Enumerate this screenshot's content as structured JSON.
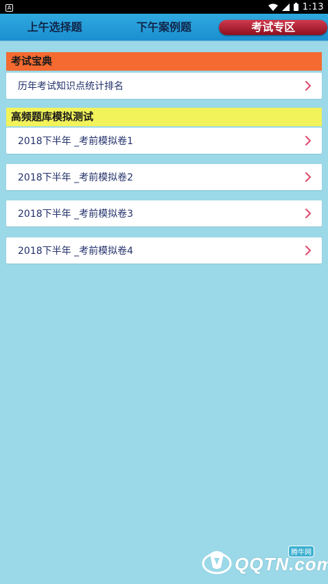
{
  "status_bar": {
    "notification_icon": "A",
    "time": "1:13"
  },
  "tabs": [
    {
      "label": "上午选择题"
    },
    {
      "label": "下午案例题"
    },
    {
      "label": "考试专区"
    }
  ],
  "sections": [
    {
      "title": "考试宝典",
      "items": [
        {
          "label": "历年考试知识点统计排名"
        }
      ]
    },
    {
      "title": "高频题库模拟测试",
      "items": [
        {
          "label": "2018下半年 _考前模拟卷1"
        },
        {
          "label": "2018下半年 _考前模拟卷2"
        },
        {
          "label": "2018下半年 _考前模拟卷3"
        },
        {
          "label": "2018下半年 _考前模拟卷4"
        }
      ]
    }
  ],
  "watermark": {
    "text": "QQTN.com",
    "badge": "腾牛网"
  },
  "colors": {
    "background": "#9bd8e8",
    "header_orange": "#f46a30",
    "header_yellow": "#f2f25a",
    "active_tab": "#a8172b",
    "chevron": "#e05070"
  }
}
